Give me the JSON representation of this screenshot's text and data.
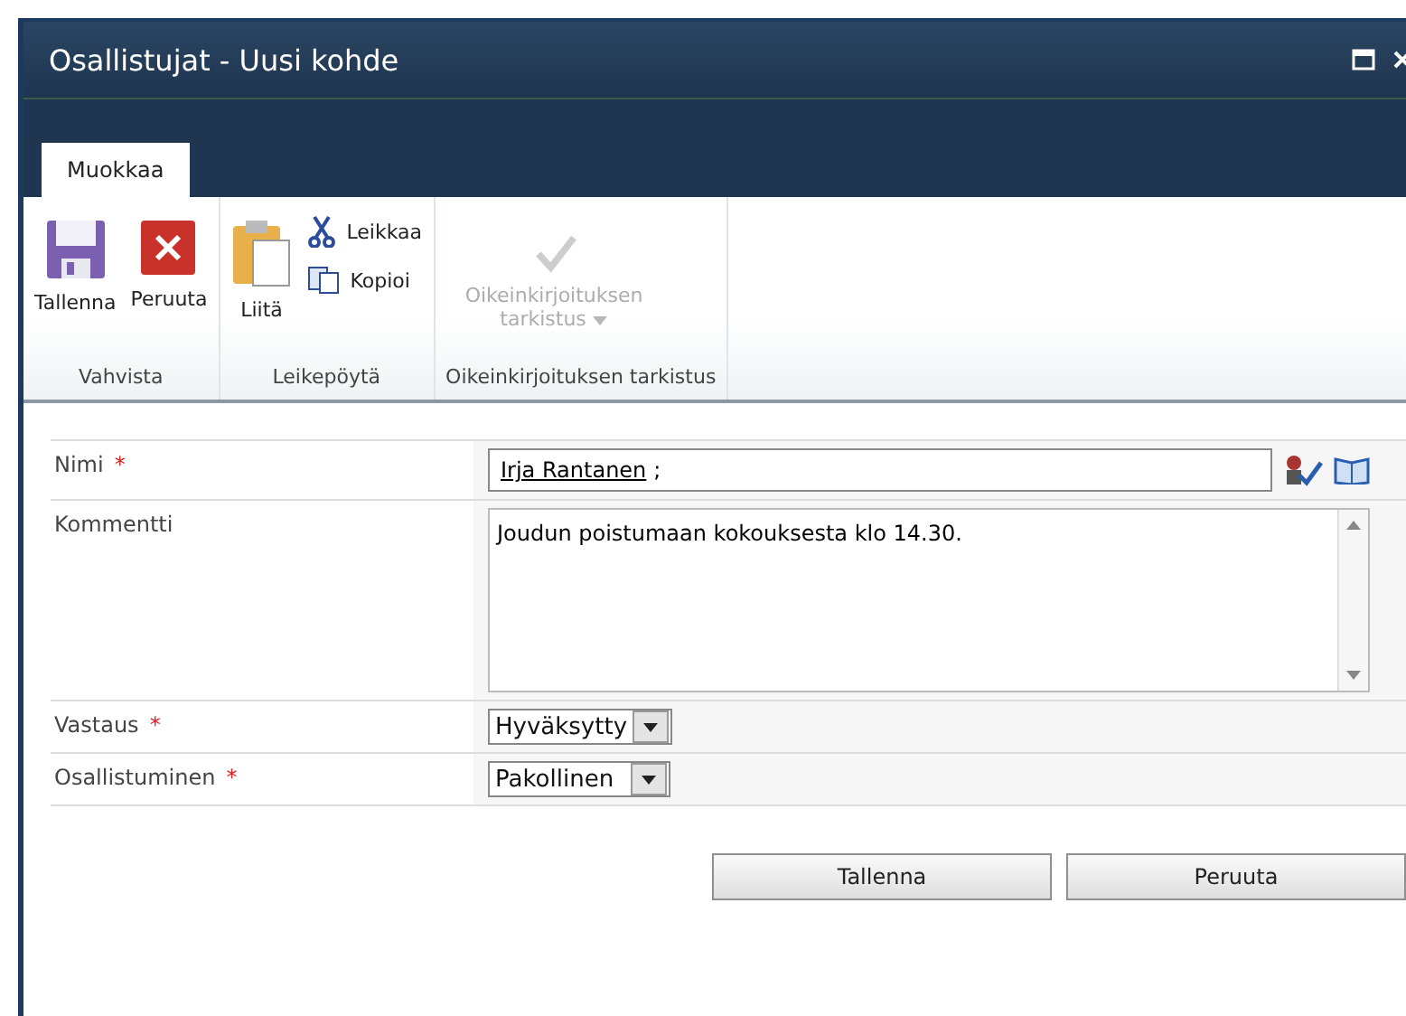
{
  "window": {
    "title": "Osallistujat - Uusi kohde"
  },
  "tabs": [
    {
      "label": "Muokkaa",
      "selected": true
    }
  ],
  "ribbon_groups": [
    {
      "label": "Vahvista",
      "items": [
        {
          "kind": "save",
          "label": "Tallenna",
          "disabled": false
        },
        {
          "kind": "cancel",
          "label": "Peruuta",
          "disabled": false
        }
      ]
    },
    {
      "label": "Leikepöytä",
      "items": [
        {
          "kind": "paste",
          "label": "Liitä",
          "disabled": false
        },
        {
          "kind": "cut",
          "label": "Leikkaa",
          "disabled": false
        },
        {
          "kind": "copy",
          "label": "Kopioi",
          "disabled": false
        }
      ]
    },
    {
      "label": "Oikeinkirjoituksen tarkistus",
      "items": [
        {
          "kind": "spelling",
          "label": "Oikeinkirjoituksen tarkistus",
          "disabled": true
        }
      ]
    }
  ],
  "fields": [
    {
      "kind": "people",
      "label": "Nimi",
      "required_mark": "*",
      "person": "Irja Rantanen",
      "separator": ";"
    },
    {
      "kind": "textarea",
      "label": "Kommentti",
      "value": "Joudun poistumaan kokouksesta klo 14.30."
    },
    {
      "kind": "select",
      "label": "Vastaus",
      "required_mark": "*",
      "value": "Hyväksytty"
    },
    {
      "kind": "select",
      "label": "Osallistuminen",
      "required_mark": "*",
      "value": "Pakollinen"
    }
  ],
  "buttons": [
    "Tallenna",
    "Peruuta"
  ]
}
